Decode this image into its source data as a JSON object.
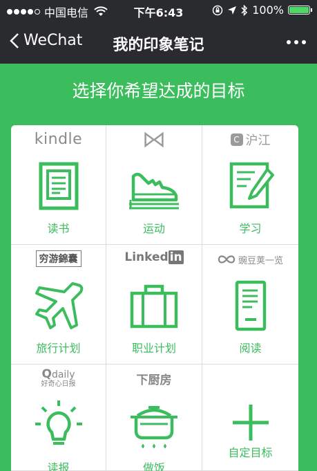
{
  "status_bar": {
    "carrier": "中国电信",
    "time": "下午6:43",
    "battery": "100%"
  },
  "nav": {
    "back_label": "WeChat",
    "title": "我的印象笔记"
  },
  "subtitle": "选择你希望达成的目标",
  "goals": [
    {
      "brand": "kindle",
      "label": "读书",
      "icon": "book-icon"
    },
    {
      "brand": "",
      "label": "运动",
      "icon": "sneaker-icon"
    },
    {
      "brand": "沪江",
      "label": "学习",
      "icon": "notebook-pen-icon"
    },
    {
      "brand": "穷游錦囊",
      "label": "旅行计划",
      "icon": "airplane-icon"
    },
    {
      "brand": "Linked",
      "brand_suffix": "in",
      "label": "职业计划",
      "icon": "briefcase-icon"
    },
    {
      "brand": "豌豆荚一览",
      "label": "阅读",
      "icon": "tablet-icon"
    },
    {
      "brand": "daily",
      "brand_sub": "好奇心日报",
      "label": "读报",
      "icon": "lightbulb-icon"
    },
    {
      "brand": "下厨房",
      "label": "做饭",
      "icon": "cooking-pot-icon"
    },
    {
      "brand": "",
      "label": "自定目标",
      "icon": "plus-icon"
    }
  ],
  "colors": {
    "accent": "#3bbd5e",
    "nav_bg": "#2a2b2f"
  }
}
